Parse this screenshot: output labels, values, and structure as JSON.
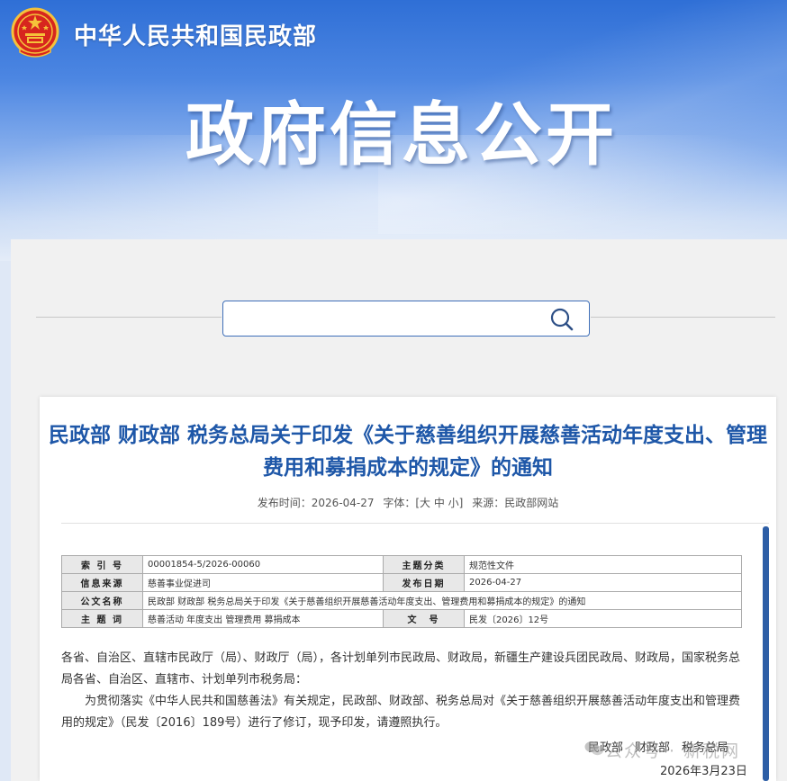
{
  "header": {
    "ministry_name": "中华人民共和国民政部",
    "section_title": "政府信息公开",
    "emblem_icon": "national-emblem-icon"
  },
  "search": {
    "placeholder": "",
    "icon": "search-icon",
    "accent_color": "#3f6fb8"
  },
  "article": {
    "title": "民政部 财政部 税务总局关于印发《关于慈善组织开展慈善活动年度支出、管理费用和募捐成本的规定》的通知",
    "meta": {
      "publish_label": "发布时间：2026-04-27",
      "font_label": "字体：[大 中 小]",
      "source_label": "来源：民政部网站"
    },
    "info_table": {
      "rows": [
        [
          "索 引 号",
          "00001854-5/2026-00060",
          "主题分类",
          "规范性文件"
        ],
        [
          "信息来源",
          "慈善事业促进司",
          "发布日期",
          "2026-04-27"
        ],
        [
          "公文名称",
          "民政部 财政部 税务总局关于印发《关于慈善组织开展慈善活动年度支出、管理费用和募捐成本的规定》的通知"
        ],
        [
          "主 题 词",
          "慈善活动 年度支出 管理费用 募捐成本",
          "文　号",
          "民发〔2026〕12号"
        ]
      ]
    },
    "body": {
      "para1": "各省、自治区、直辖市民政厅（局）、财政厅（局），各计划单列市民政局、财政局，新疆生产建设兵团民政局、财政局，国家税务总局各省、自治区、直辖市、计划单列市税务局：",
      "para2": "为贯彻落实《中华人民共和国慈善法》有关规定，民政部、财政部、税务总局对《关于慈善组织开展慈善活动年度支出和管理费用的规定》（民发〔2016〕189号）进行了修订，现予印发，请遵照执行。"
    },
    "signers": "民政部　财政部　税务总局",
    "sign_date": "2026年3月23日"
  },
  "watermark": {
    "text": "公众号 · 新税网",
    "icon": "wechat-icon"
  },
  "colors": {
    "title_blue": "#1e57a8",
    "banner_blue": "#2f6fd6",
    "scrollbar": "#2d5ea6"
  }
}
